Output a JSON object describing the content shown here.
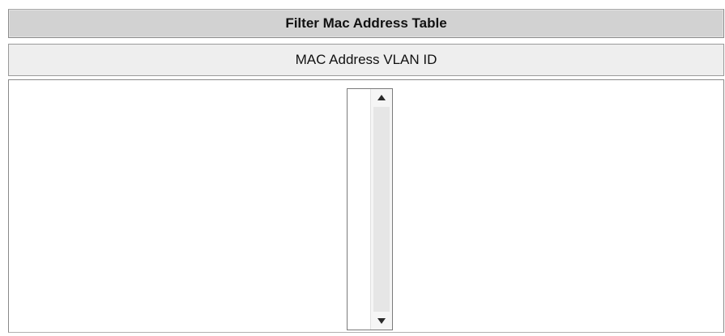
{
  "table": {
    "title": "Filter Mac Address Table",
    "header": "MAC Address VLAN ID",
    "entries": []
  },
  "icons": {
    "scroll_up": "triangle-up-icon",
    "scroll_down": "triangle-down-icon"
  }
}
